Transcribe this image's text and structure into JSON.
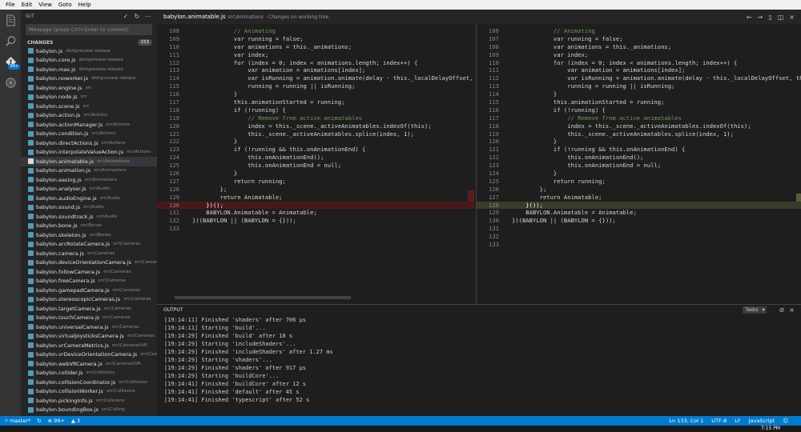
{
  "menu": [
    "File",
    "Edit",
    "View",
    "Goto",
    "Help"
  ],
  "activity": {
    "items": [
      {
        "name": "explore-icon"
      },
      {
        "name": "search-icon"
      },
      {
        "name": "git-icon",
        "badge": "99+"
      },
      {
        "name": "debug-icon"
      }
    ]
  },
  "sidebar": {
    "title": "GIT",
    "commit_placeholder": "Message (press Ctrl+Enter to commit)",
    "changes_label": "CHANGES",
    "changes_count": "153",
    "files": [
      {
        "name": "babylon.js",
        "path": "dist\\preview release"
      },
      {
        "name": "babylon.core.js",
        "path": "dist\\preview release"
      },
      {
        "name": "babylon.max.js",
        "path": "dist\\preview release"
      },
      {
        "name": "babylon.noworker.js",
        "path": "dist\\preview release"
      },
      {
        "name": "babylon.engine.js",
        "path": "src"
      },
      {
        "name": "babylon.node.js",
        "path": "src"
      },
      {
        "name": "babylon.scene.js",
        "path": "src"
      },
      {
        "name": "babylon.action.js",
        "path": "src\\Actions"
      },
      {
        "name": "babylon.actionManager.js",
        "path": "src\\Actions"
      },
      {
        "name": "babylon.condition.js",
        "path": "src\\Actions"
      },
      {
        "name": "babylon.directActions.js",
        "path": "src\\Actions"
      },
      {
        "name": "babylon.interpolateValueAction.js",
        "path": "src\\Actions"
      },
      {
        "name": "babylon.animatable.js",
        "path": "src\\Animations",
        "selected": true
      },
      {
        "name": "babylon.animation.js",
        "path": "src\\Animations"
      },
      {
        "name": "babylon.easing.js",
        "path": "src\\Animations"
      },
      {
        "name": "babylon.analyser.js",
        "path": "src\\Audio"
      },
      {
        "name": "babylon.audioEngine.js",
        "path": "src\\Audio"
      },
      {
        "name": "babylon.sound.js",
        "path": "src\\Audio"
      },
      {
        "name": "babylon.soundtrack.js",
        "path": "src\\Audio"
      },
      {
        "name": "babylon.bone.js",
        "path": "src\\Bones"
      },
      {
        "name": "babylon.skeleton.js",
        "path": "src\\Bones"
      },
      {
        "name": "babylon.arcRotateCamera.js",
        "path": "src\\Cameras"
      },
      {
        "name": "babylon.camera.js",
        "path": "src\\Cameras"
      },
      {
        "name": "babylon.deviceOrientationCamera.js",
        "path": "src\\Cameras"
      },
      {
        "name": "babylon.followCamera.js",
        "path": "src\\Cameras"
      },
      {
        "name": "babylon.freeCamera.js",
        "path": "src\\Cameras"
      },
      {
        "name": "babylon.gamepadCamera.js",
        "path": "src\\Cameras"
      },
      {
        "name": "babylon.stereoscopicCameras.js",
        "path": "src\\Cameras"
      },
      {
        "name": "babylon.targetCamera.js",
        "path": "src\\Cameras"
      },
      {
        "name": "babylon.touchCamera.js",
        "path": "src\\Cameras"
      },
      {
        "name": "babylon.universalCamera.js",
        "path": "src\\Cameras"
      },
      {
        "name": "babylon.virtualJoysticksCamera.js",
        "path": "src\\Cameras"
      },
      {
        "name": "babylon.vrCameraMetrics.js",
        "path": "src\\Cameras\\VR"
      },
      {
        "name": "babylon.vrDeviceOrientationCamera.js",
        "path": "src\\Came..."
      },
      {
        "name": "babylon.webVRCamera.js",
        "path": "src\\Cameras\\VR"
      },
      {
        "name": "babylon.collider.js",
        "path": "src\\Collisions"
      },
      {
        "name": "babylon.collisionCoordinator.js",
        "path": "src\\Collisions"
      },
      {
        "name": "babylon.collisionWorker.js",
        "path": "src\\Collisions"
      },
      {
        "name": "babylon.pickingInfo.js",
        "path": "src\\Collisions"
      },
      {
        "name": "babylon.boundingBox.js",
        "path": "src\\Culling"
      }
    ]
  },
  "editor": {
    "tab_name": "babylon.animatable.js",
    "tab_desc": "src\\Animations - Changes on working tree",
    "left_lines": [
      {
        "n": "108",
        "t": "            // Animating",
        "k": "cm"
      },
      {
        "n": "109",
        "t": "            var running = false;"
      },
      {
        "n": "110",
        "t": "            var animations = this._animations;"
      },
      {
        "n": "111",
        "t": "            var index;"
      },
      {
        "n": "112",
        "t": "            for (index = 0; index < animations.length; index++) {"
      },
      {
        "n": "113",
        "t": "                var animation = animations[index];"
      },
      {
        "n": "114",
        "t": "                var isRunning = animation.animate(delay - this._localDelayOffset, this.fromF"
      },
      {
        "n": "115",
        "t": "                running = running || isRunning;"
      },
      {
        "n": "116",
        "t": "            }"
      },
      {
        "n": "117",
        "t": "            this.animationStarted = running;"
      },
      {
        "n": "118",
        "t": "            if (!running) {"
      },
      {
        "n": "119",
        "t": "                // Remove from active animatables",
        "k": "cm"
      },
      {
        "n": "120",
        "t": "                index = this._scene._activeAnimatables.indexOf(this);"
      },
      {
        "n": "121",
        "t": "                this._scene._activeAnimatables.splice(index, 1);"
      },
      {
        "n": "122",
        "t": "            }"
      },
      {
        "n": "123",
        "t": "            if (!running && this.onAnimationEnd) {"
      },
      {
        "n": "124",
        "t": "                this.onAnimationEnd();"
      },
      {
        "n": "125",
        "t": "                this.onAnimationEnd = null;"
      },
      {
        "n": "126",
        "t": "            }"
      },
      {
        "n": "127",
        "t": "            return running;"
      },
      {
        "n": "128",
        "t": "        };"
      },
      {
        "n": "129",
        "t": "        return Animatable;"
      },
      {
        "n": "130",
        "t": "    })();",
        "d": "del"
      },
      {
        "n": "131",
        "t": "    BABYLON.Animatable = Animatable;"
      },
      {
        "n": "132",
        "t": "})(BABYLON || (BABYLON = {}));"
      },
      {
        "n": "133",
        "t": ""
      }
    ],
    "right_lines": [
      {
        "n": "106",
        "t": "            // Animating",
        "k": "cm"
      },
      {
        "n": "107",
        "t": "            var running = false;"
      },
      {
        "n": "108",
        "t": "            var animations = this._animations;"
      },
      {
        "n": "109",
        "t": "            var index;"
      },
      {
        "n": "110",
        "t": "            for (index = 0; index < animations.length; index++) {"
      },
      {
        "n": "111",
        "t": "                var animation = animations[index];"
      },
      {
        "n": "112",
        "t": "                var isRunning = animation.animate(delay - this._localDelayOffset, this.fromF"
      },
      {
        "n": "113",
        "t": "                running = running || isRunning;"
      },
      {
        "n": "114",
        "t": "            }"
      },
      {
        "n": "115",
        "t": "            this.animationStarted = running;"
      },
      {
        "n": "116",
        "t": "            if (!running) {"
      },
      {
        "n": "117",
        "t": "                // Remove from active animatables",
        "k": "cm"
      },
      {
        "n": "118",
        "t": "                index = this._scene._activeAnimatables.indexOf(this);"
      },
      {
        "n": "119",
        "t": "                this._scene._activeAnimatables.splice(index, 1);"
      },
      {
        "n": "120",
        "t": "            }"
      },
      {
        "n": "121",
        "t": "            if (!running && this.onAnimationEnd) {"
      },
      {
        "n": "122",
        "t": "                this.onAnimationEnd();"
      },
      {
        "n": "123",
        "t": "                this.onAnimationEnd = null;"
      },
      {
        "n": "124",
        "t": "            }"
      },
      {
        "n": "125",
        "t": "            return running;"
      },
      {
        "n": "126",
        "t": "        };"
      },
      {
        "n": "127",
        "t": "        return Animatable;"
      },
      {
        "n": "128",
        "t": "    }());",
        "d": "add"
      },
      {
        "n": "129",
        "t": "    BABYLON.Animatable = Animatable;"
      },
      {
        "n": "130",
        "t": "})(BABYLON || (BABYLON = {}));"
      },
      {
        "n": "131",
        "t": ""
      },
      {
        "n": "132",
        "t": ""
      },
      {
        "n": "133",
        "t": ""
      }
    ]
  },
  "panel": {
    "title": "OUTPUT",
    "select_value": "Tasks",
    "lines": [
      "[19:14:11] Finished 'shaders' after 706 μs",
      "[19:14:11] Starting 'build'...",
      "[19:14:29] Finished 'build' after 18 s",
      "[19:14:29] Starting 'includeShaders'...",
      "[19:14:29] Finished 'includeShaders' after 1.27 ms",
      "[19:14:29] Starting 'shaders'...",
      "[19:14:29] Finished 'shaders' after 917 μs",
      "[19:14:29] Starting 'buildCore'...",
      "[19:14:41] Finished 'buildCore' after 12 s",
      "[19:14:41] Finished 'default' after 45 s",
      "[19:14:41] Finished 'typescript' after 52 s"
    ]
  },
  "status": {
    "branch": "master*",
    "problems": "99+",
    "warnings": "3",
    "position": "Ln 133, Col 1",
    "encoding": "UTF-8",
    "eol": "LF",
    "language": "JavaScript"
  },
  "taskbar": {
    "clock": "7:15 PM"
  },
  "colors": {
    "accent": "#007acc",
    "deleted_line": "#4b1818",
    "added_line": "#373d29"
  }
}
